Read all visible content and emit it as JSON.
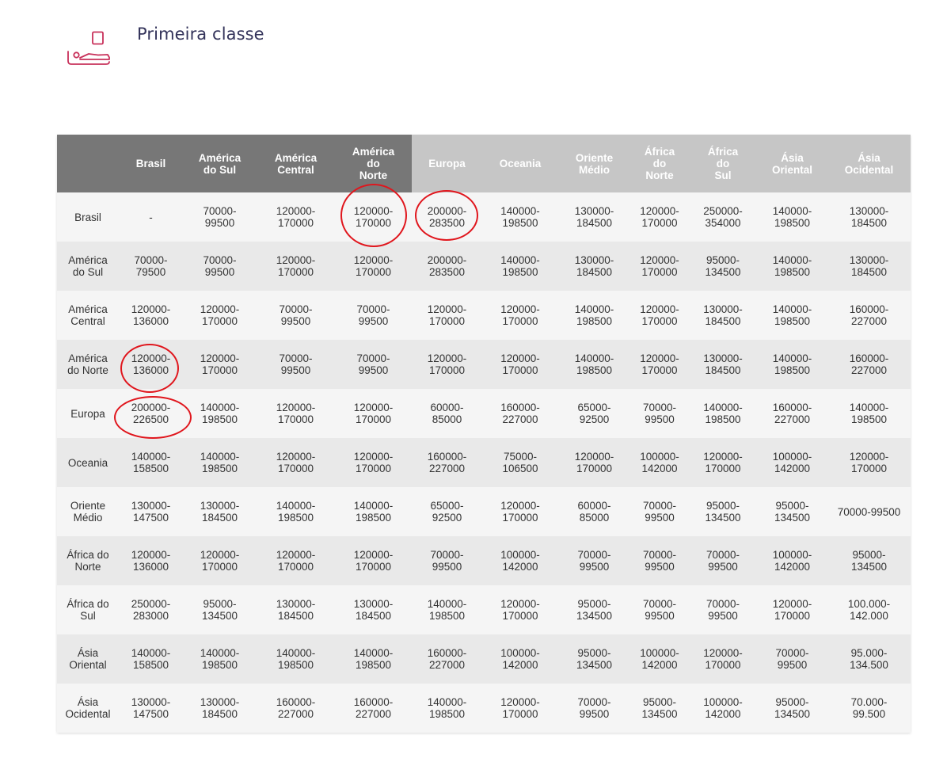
{
  "section": {
    "icon": "flat-bed-seat-icon",
    "title": "Primeira classe"
  },
  "colors": {
    "accent": "#c8305a",
    "header_dark": "#777777",
    "header_light": "#c6c6c6",
    "highlight_circle": "#e0161d"
  },
  "table": {
    "corner": "",
    "columns": [
      "Brasil",
      "América\ndo Sul",
      "América\nCentral",
      "América\ndo\nNorte",
      "Europa",
      "Oceania",
      "Oriente\nMédio",
      "África\ndo\nNorte",
      "África\ndo\nSul",
      "Ásia\nOriental",
      "Ásia\nOcidental"
    ],
    "rows": [
      {
        "label": "Brasil",
        "cells": [
          "-",
          "70000-\n99500",
          "120000-\n170000",
          "120000-\n170000",
          "200000-\n283500",
          "140000-\n198500",
          "130000-\n184500",
          "120000-\n170000",
          "250000-\n354000",
          "140000-\n198500",
          "130000-\n184500"
        ]
      },
      {
        "label": "América\ndo Sul",
        "cells": [
          "70000-\n79500",
          "70000-\n99500",
          "120000-\n170000",
          "120000-\n170000",
          "200000-\n283500",
          "140000-\n198500",
          "130000-\n184500",
          "120000-\n170000",
          "95000-\n134500",
          "140000-\n198500",
          "130000-\n184500"
        ]
      },
      {
        "label": "América\nCentral",
        "cells": [
          "120000-\n136000",
          "120000-\n170000",
          "70000-\n99500",
          "70000-\n99500",
          "120000-\n170000",
          "120000-\n170000",
          "140000-\n198500",
          "120000-\n170000",
          "130000-\n184500",
          "140000-\n198500",
          "160000-\n227000"
        ]
      },
      {
        "label": "América\ndo Norte",
        "cells": [
          "120000-\n136000",
          "120000-\n170000",
          "70000-\n99500",
          "70000-\n99500",
          "120000-\n170000",
          "120000-\n170000",
          "140000-\n198500",
          "120000-\n170000",
          "130000-\n184500",
          "140000-\n198500",
          "160000-\n227000"
        ]
      },
      {
        "label": "Europa",
        "cells": [
          "200000-\n226500",
          "140000-\n198500",
          "120000-\n170000",
          "120000-\n170000",
          "60000-\n85000",
          "160000-\n227000",
          "65000-\n92500",
          "70000-\n99500",
          "140000-\n198500",
          "160000-\n227000",
          "140000-\n198500"
        ]
      },
      {
        "label": "Oceania",
        "cells": [
          "140000-\n158500",
          "140000-\n198500",
          "120000-\n170000",
          "120000-\n170000",
          "160000-\n227000",
          "75000-\n106500",
          "120000-\n170000",
          "100000-\n142000",
          "120000-\n170000",
          "100000-\n142000",
          "120000-\n170000"
        ]
      },
      {
        "label": "Oriente\nMédio",
        "cells": [
          "130000-\n147500",
          "130000-\n184500",
          "140000-\n198500",
          "140000-\n198500",
          "65000-\n92500",
          "120000-\n170000",
          "60000-\n85000",
          "70000-\n99500",
          "95000-\n134500",
          "95000-\n134500",
          "70000-99500"
        ]
      },
      {
        "label": "África do\nNorte",
        "cells": [
          "120000-\n136000",
          "120000-\n170000",
          "120000-\n170000",
          "120000-\n170000",
          "70000-\n99500",
          "100000-\n142000",
          "70000-\n99500",
          "70000-\n99500",
          "70000-\n99500",
          "100000-\n142000",
          "95000-\n134500"
        ]
      },
      {
        "label": "África do\nSul",
        "cells": [
          "250000-\n283000",
          "95000-\n134500",
          "130000-\n184500",
          "130000-\n184500",
          "140000-\n198500",
          "120000-\n170000",
          "95000-\n134500",
          "70000-\n99500",
          "70000-\n99500",
          "120000-\n170000",
          "100.000-\n142.000"
        ]
      },
      {
        "label": "Ásia\nOriental",
        "cells": [
          "140000-\n158500",
          "140000-\n198500",
          "140000-\n198500",
          "140000-\n198500",
          "160000-\n227000",
          "100000-\n142000",
          "95000-\n134500",
          "100000-\n142000",
          "120000-\n170000",
          "70000-\n99500",
          "95.000-\n134.500"
        ]
      },
      {
        "label": "Ásia\nOcidental",
        "cells": [
          "130000-\n147500",
          "130000-\n184500",
          "160000-\n227000",
          "160000-\n227000",
          "140000-\n198500",
          "120000-\n170000",
          "70000-\n99500",
          "95000-\n134500",
          "100000-\n142000",
          "95000-\n134500",
          "70.000-\n99.500"
        ]
      }
    ],
    "highlighted_cells": [
      {
        "row": "Brasil",
        "column": "América do Norte"
      },
      {
        "row": "Brasil",
        "column": "Europa"
      },
      {
        "row": "América do Norte",
        "column": "Brasil"
      },
      {
        "row": "Europa",
        "column": "Brasil"
      }
    ]
  }
}
